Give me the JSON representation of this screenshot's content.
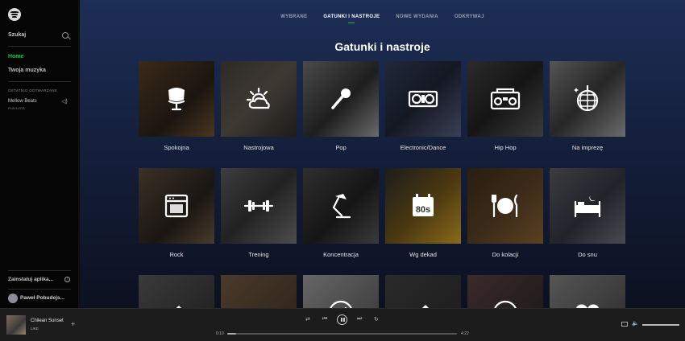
{
  "sidebar": {
    "search_label": "Szukaj",
    "nav": {
      "home": "Home",
      "library": "Twoja muzyka"
    },
    "recent_header": "OSTATNIO ODTWARZANE",
    "recent_item": {
      "name": "Mellow Beats",
      "type": "PLAYLISTA"
    },
    "install_label": "Zainstaluj aplika...",
    "user_name": "Paweł Pobudejs..."
  },
  "tabs": [
    {
      "label": "WYBRANE",
      "active": false
    },
    {
      "label": "GATUNKI I NASTROJE",
      "active": true
    },
    {
      "label": "NOWE WYDANIA",
      "active": false
    },
    {
      "label": "ODKRYWAJ",
      "active": false
    }
  ],
  "heading": "Gatunki i nastroje",
  "genres": [
    {
      "label": "Spokojna",
      "icon": "armchair-icon"
    },
    {
      "label": "Nastrojowa",
      "icon": "cloud-sun-icon"
    },
    {
      "label": "Pop",
      "icon": "microphone-icon"
    },
    {
      "label": "Electronic/Dance",
      "icon": "turntable-icon"
    },
    {
      "label": "Hip Hop",
      "icon": "boombox-icon"
    },
    {
      "label": "Na imprezę",
      "icon": "disco-ball-icon"
    },
    {
      "label": "Rock",
      "icon": "amplifier-icon"
    },
    {
      "label": "Trening",
      "icon": "dumbbell-icon"
    },
    {
      "label": "Koncentracja",
      "icon": "desk-lamp-icon"
    },
    {
      "label": "Wg dekad",
      "icon": "calendar-80s-icon",
      "icon_text": "80s"
    },
    {
      "label": "Do kolacji",
      "icon": "plate-cutlery-icon"
    },
    {
      "label": "Do snu",
      "icon": "bed-icon"
    },
    {
      "label": "",
      "icon": "guitar-icon"
    },
    {
      "label": "",
      "icon": "glasses-icon"
    },
    {
      "label": "",
      "icon": "compass-icon"
    },
    {
      "label": "",
      "icon": "electric-guitar-icon"
    },
    {
      "label": "",
      "icon": "circle-icon"
    },
    {
      "label": "",
      "icon": "heart-icon"
    }
  ],
  "player": {
    "track": "Chilean Sunset",
    "artist": "LIKE",
    "elapsed": "0:10",
    "duration": "4:22",
    "progress": 0.04,
    "volume": 1.0
  },
  "colors": {
    "accent": "#1db954",
    "main_top": "#1d2e57",
    "sidebar": "#050505",
    "player": "#1c1c1c"
  }
}
